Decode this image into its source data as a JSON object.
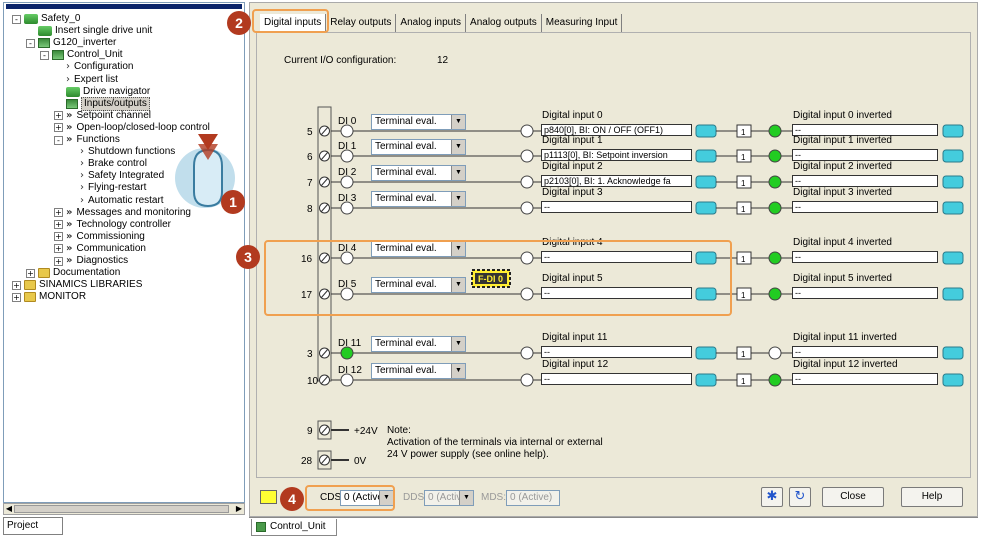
{
  "tree": {
    "items": [
      {
        "label": "Safety_0",
        "indent": 0,
        "expander": "-",
        "icon": "project-icon"
      },
      {
        "label": "Insert single drive unit",
        "indent": 1,
        "expander": "",
        "icon": "insert-drive-icon"
      },
      {
        "label": "G120_inverter",
        "indent": 1,
        "expander": "-",
        "icon": "inverter-icon"
      },
      {
        "label": "Control_Unit",
        "indent": 2,
        "expander": "-",
        "icon": "control-unit-icon"
      },
      {
        "label": "Configuration",
        "indent": 3,
        "expander": "",
        "icon": "chevron-right-icon"
      },
      {
        "label": "Expert list",
        "indent": 3,
        "expander": "",
        "icon": "chevron-right-icon"
      },
      {
        "label": "Drive navigator",
        "indent": 3,
        "expander": "",
        "icon": "drive-navigator-icon"
      },
      {
        "label": "Inputs/outputs",
        "indent": 3,
        "expander": "",
        "icon": "inputs-outputs-icon"
      },
      {
        "label": "Setpoint channel",
        "indent": 3,
        "expander": "+",
        "icon": "double-chevron-icon"
      },
      {
        "label": "Open-loop/closed-loop control",
        "indent": 3,
        "expander": "+",
        "icon": "double-chevron-icon"
      },
      {
        "label": "Functions",
        "indent": 3,
        "expander": "-",
        "icon": "double-chevron-icon"
      },
      {
        "label": "Shutdown functions",
        "indent": 4,
        "expander": "",
        "icon": "chevron-right-icon"
      },
      {
        "label": "Brake control",
        "indent": 4,
        "expander": "",
        "icon": "chevron-right-icon"
      },
      {
        "label": "Safety Integrated",
        "indent": 4,
        "expander": "",
        "icon": "chevron-right-icon"
      },
      {
        "label": "Flying-restart",
        "indent": 4,
        "expander": "",
        "icon": "chevron-right-icon"
      },
      {
        "label": "Automatic restart",
        "indent": 4,
        "expander": "",
        "icon": "chevron-right-icon"
      },
      {
        "label": "Messages and monitoring",
        "indent": 3,
        "expander": "+",
        "icon": "double-chevron-icon"
      },
      {
        "label": "Technology controller",
        "indent": 3,
        "expander": "+",
        "icon": "double-chevron-icon"
      },
      {
        "label": "Commissioning",
        "indent": 3,
        "expander": "+",
        "icon": "double-chevron-icon"
      },
      {
        "label": "Communication",
        "indent": 3,
        "expander": "+",
        "icon": "double-chevron-icon"
      },
      {
        "label": "Diagnostics",
        "indent": 3,
        "expander": "+",
        "icon": "double-chevron-icon"
      },
      {
        "label": "Documentation",
        "indent": 1,
        "expander": "+",
        "icon": "folder-icon"
      },
      {
        "label": "SINAMICS LIBRARIES",
        "indent": 0,
        "expander": "+",
        "icon": "folder-icon"
      },
      {
        "label": "MONITOR",
        "indent": 0,
        "expander": "+",
        "icon": "folder-icon"
      }
    ],
    "project_tab": "Project"
  },
  "tabs": [
    "Digital inputs",
    "Relay outputs",
    "Analog inputs",
    "Analog outputs",
    "Measuring Input"
  ],
  "config_label": "Current I/O configuration:",
  "config_value": "12",
  "eval_label": "Terminal eval.",
  "inverter_block": "1",
  "rows": [
    {
      "terminal": "5",
      "di": "DI 0",
      "led": "off",
      "input_label": "Digital input 0",
      "input_value": "p840[0], BI: ON / OFF (OFF1)",
      "inv_label": "Digital input 0 inverted",
      "inv_value": "--",
      "inv_led": "green"
    },
    {
      "terminal": "6",
      "di": "DI 1",
      "led": "off",
      "input_label": "Digital input 1",
      "input_value": "p1113[0], BI: Setpoint inversion",
      "inv_label": "Digital input 1 inverted",
      "inv_value": "--",
      "inv_led": "green"
    },
    {
      "terminal": "7",
      "di": "DI 2",
      "led": "off",
      "input_label": "Digital input 2",
      "input_value": "p2103[0], BI: 1. Acknowledge fa",
      "inv_label": "Digital input 2 inverted",
      "inv_value": "--",
      "inv_led": "green"
    },
    {
      "terminal": "8",
      "di": "DI 3",
      "led": "off",
      "input_label": "Digital input 3",
      "input_value": "--",
      "inv_label": "Digital input 3 inverted",
      "inv_value": "--",
      "inv_led": "green"
    },
    {
      "terminal": "16",
      "di": "DI 4",
      "led": "off",
      "input_label": "Digital input 4",
      "input_value": "--",
      "inv_label": "Digital input 4 inverted",
      "inv_value": "--",
      "inv_led": "green"
    },
    {
      "terminal": "17",
      "di": "DI 5",
      "led": "off",
      "input_label": "Digital input 5",
      "input_value": "--",
      "inv_label": "Digital input 5 inverted",
      "inv_value": "--",
      "inv_led": "green",
      "fdi": "F-DI 0"
    },
    {
      "terminal": "3",
      "di": "DI 11",
      "led": "green",
      "input_label": "Digital input 11",
      "input_value": "--",
      "inv_label": "Digital input 11 inverted",
      "inv_value": "--",
      "inv_led": "off"
    },
    {
      "terminal": "10",
      "di": "DI 12",
      "led": "off",
      "input_label": "Digital input 12",
      "input_value": "--",
      "inv_label": "Digital input 12 inverted",
      "inv_value": "--",
      "inv_led": "green"
    }
  ],
  "power": {
    "t9": "9",
    "t28": "28",
    "v24": "+24V",
    "v0": "0V",
    "note_title": "Note:",
    "note_line1": "Activation of the terminals via internal or external",
    "note_line2": "24 V power supply (see online help)."
  },
  "bottom": {
    "cds_label": "CDS:",
    "cds_value": "0 (Active)",
    "dds_label": "DDS:",
    "dds_value": "0 (Active)",
    "mds_label": "MDS:",
    "mds_value": "0 (Active)",
    "close_label": "Close",
    "help_label": "Help"
  },
  "bottom_tab": "Control_Unit",
  "callouts": [
    "1",
    "2",
    "3",
    "4"
  ],
  "colors": {
    "led_green": "#22cc22",
    "connector": "#44ccdd",
    "callout": "#b23a1f",
    "callout_box": "#f0a050"
  }
}
